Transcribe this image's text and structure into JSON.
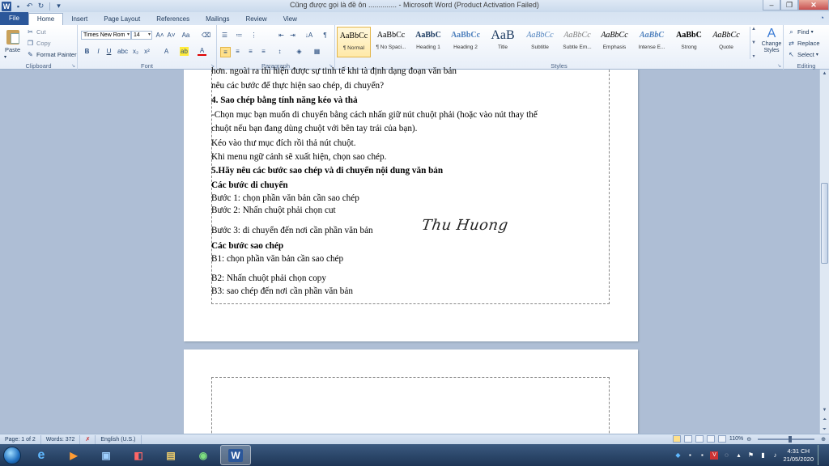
{
  "window": {
    "title": "Cũng được gọi là đề ôn .............. - Microsoft Word (Product Activation Failed)"
  },
  "tabs": [
    "File",
    "Home",
    "Insert",
    "Page Layout",
    "References",
    "Mailings",
    "Review",
    "View"
  ],
  "active_tab": "Home",
  "clipboard": {
    "paste": "Paste",
    "cut": "Cut",
    "copy": "Copy",
    "format_painter": "Format Painter",
    "label": "Clipboard"
  },
  "font": {
    "family": "Times New Rom",
    "size": "14",
    "label": "Font"
  },
  "paragraph": {
    "label": "Paragraph"
  },
  "styles": {
    "label": "Styles",
    "items": [
      {
        "sample": "AaBbCc",
        "name": "¶ Normal"
      },
      {
        "sample": "AaBbCc",
        "name": "¶ No Spaci..."
      },
      {
        "sample": "AaBbC",
        "name": "Heading 1"
      },
      {
        "sample": "AaBbCc",
        "name": "Heading 2"
      },
      {
        "sample": "AaB",
        "name": "Title"
      },
      {
        "sample": "AaBbCc",
        "name": "Subtitle"
      },
      {
        "sample": "AaBbCc",
        "name": "Subtle Em..."
      },
      {
        "sample": "AaBbCc",
        "name": "Emphasis"
      },
      {
        "sample": "AaBbC",
        "name": "Intense E..."
      },
      {
        "sample": "AaBbC",
        "name": "Strong"
      },
      {
        "sample": "AaBbCc",
        "name": "Quote"
      }
    ],
    "change_styles": "Change Styles"
  },
  "editing": {
    "find": "Find",
    "replace": "Replace",
    "select": "Select",
    "label": "Editing"
  },
  "document": {
    "lines": [
      {
        "text": "hơn. ngoài ra thì hiện được sự tinh tế khi tà định dạng đoạn văn bản",
        "bold": false
      },
      {
        "text": "nêu các bước để thực hiện sao chép, di chuyển?",
        "bold": false
      },
      {
        "text": "4. Sao chép bằng tính năng kéo và thả",
        "bold": true
      },
      {
        "text": "-Chọn mục bạn muốn di chuyển bằng cách nhấn giữ nút chuột phải (hoặc vào nút thay thế",
        "bold": false
      },
      {
        "text": "chuột nếu bạn đang dùng chuột với bên tay trái của bạn).",
        "bold": false
      },
      {
        "text": "Kéo vào thư mục đích rồi thả nút chuột.",
        "bold": false
      },
      {
        "text": "Khi menu ngữ cảnh sẽ xuất hiện, chọn sao chép.",
        "bold": false
      },
      {
        "text": "5.Hãy nêu các bước sao chép và di chuyển nội dung văn bản",
        "bold": true
      },
      {
        "text": "Các bước di chuyển",
        "bold": true
      },
      {
        "text": "Bước 1: chọn phần văn bản cần sao chép",
        "bold": false
      },
      {
        "text": "Bước 2: Nhấn chuột phải chọn cut",
        "bold": false
      },
      {
        "text": "Bước 3: di chuyển đến nơi cần phần văn bản",
        "bold": false
      },
      {
        "text": "Các bước sao chép",
        "bold": true
      },
      {
        "text": "B1: chọn phần văn bản cần sao chép",
        "bold": false
      },
      {
        "text": "B2: Nhấn chuột phải chọn copy",
        "bold": false
      },
      {
        "text": "B3: sao chép đến nơi cần phần văn bản",
        "bold": false
      }
    ],
    "signature": "Thu Huong"
  },
  "status": {
    "page": "Page: 1 of 2",
    "words": "Words: 372",
    "language": "English (U.S.)",
    "zoom": "110%"
  },
  "taskbar": {
    "time": "4:31 CH",
    "date": "21/05/2020"
  }
}
